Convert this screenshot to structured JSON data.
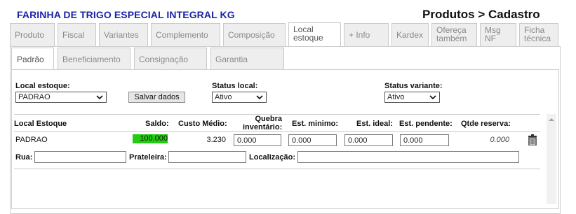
{
  "header": {
    "product_title": "FARINHA DE TRIGO ESPECIAL INTEGRAL KG",
    "page_heading": "Produtos > Cadastro"
  },
  "main_tabs": [
    {
      "label": "Produto"
    },
    {
      "label": "Fiscal"
    },
    {
      "label": "Variantes"
    },
    {
      "label": "Complemento"
    },
    {
      "label": "Composição"
    },
    {
      "label_line1": "Local",
      "label_line2": "estoque",
      "active": true
    },
    {
      "label": "+ Info"
    },
    {
      "label": "Kardex"
    },
    {
      "label_line1": "Ofereça",
      "label_line2": "também"
    },
    {
      "label_line1": "Msg",
      "label_line2": "NF"
    },
    {
      "label_line1": "Ficha",
      "label_line2": "técnica"
    }
  ],
  "sub_tabs": [
    {
      "label": "Padrão",
      "active": true
    },
    {
      "label": "Beneficiamento"
    },
    {
      "label": "Consignação"
    },
    {
      "label": "Garantia"
    }
  ],
  "filters": {
    "local_estoque_label": "Local estoque:",
    "local_estoque_value": "PADRAO",
    "save_button": "Salvar dados",
    "status_local_label": "Status local:",
    "status_local_value": "Ativo",
    "status_variante_label": "Status variante:",
    "status_variante_value": "Ativo"
  },
  "table": {
    "headers": {
      "local_estoque": "Local Estoque",
      "saldo": "Saldo:",
      "custo_medio": "Custo Médio:",
      "quebra_line1": "Quebra",
      "quebra_line2": "inventário:",
      "est_minimo": "Est. minimo:",
      "est_ideal": "Est. ideal:",
      "est_pendente": "Est. pendente:",
      "qtde_reserva": "Qtde reserva:"
    },
    "row": {
      "local": "PADRAO",
      "saldo": "100.000",
      "custo_medio": "3.230",
      "quebra_inventario": "0.000",
      "est_minimo": "0.000",
      "est_ideal": "0.000",
      "est_pendente": "0.000",
      "qtde_reserva": "0.000"
    },
    "address": {
      "rua_label": "Rua:",
      "rua_value": "",
      "prateleira_label": "Prateleira:",
      "prateleira_value": "",
      "localizacao_label": "Localização:",
      "localizacao_value": ""
    }
  },
  "colors": {
    "title_blue": "#1a23a6",
    "saldo_highlight": "#22cc11"
  },
  "icons": {
    "delete": "trash-icon",
    "scroll_up": "scroll-up-arrow-icon"
  }
}
